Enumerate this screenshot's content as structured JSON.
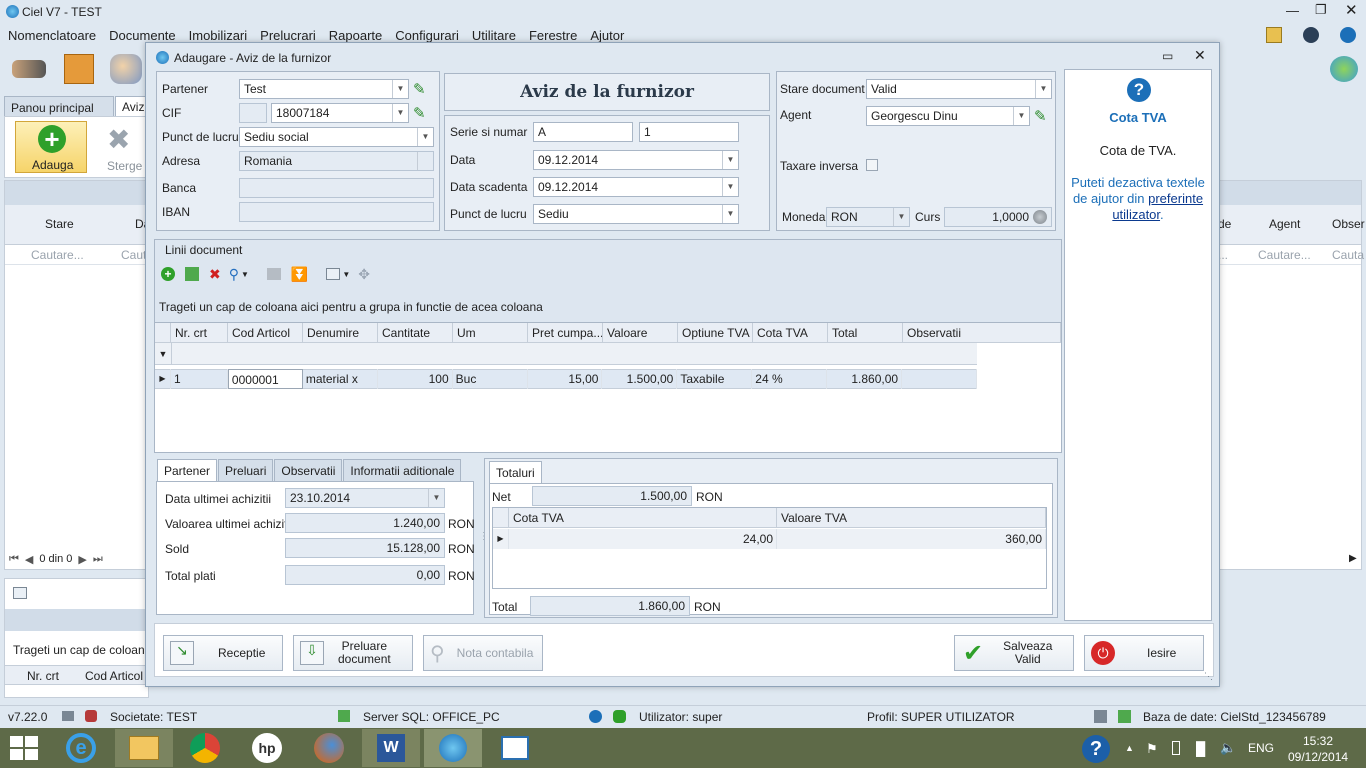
{
  "app": {
    "title": "Ciel V7 - TEST",
    "menu": [
      "Nomenclatoare",
      "Documente",
      "Imobilizari",
      "Prelucrari",
      "Rapoarte",
      "Configurari",
      "Utilitare",
      "Ferestre",
      "Ajutor"
    ]
  },
  "bg": {
    "tabs": [
      "Panou principal",
      "Aviz"
    ],
    "ribbon": {
      "add_label": "Adauga",
      "delete_label": "Sterge"
    },
    "grid_headers": [
      "Stare",
      "Da"
    ],
    "grid_headers_right": [
      "de",
      "Agent",
      "Obser"
    ],
    "search_left": [
      "Cautare...",
      "Caut"
    ],
    "search_right": [
      "...",
      "Cautare...",
      "Cauta"
    ],
    "pager": "0 din 0",
    "bottom_group_text": "Trageti un cap de coloana a",
    "bottom_headers": [
      "Nr. crt",
      "Cod Articol"
    ]
  },
  "dialog": {
    "title": "Adaugare - Aviz de la furnizor",
    "heading": "Aviz de la furnizor",
    "partner": {
      "label": "Partener",
      "value": "Test"
    },
    "cif": {
      "label": "CIF",
      "value": "18007184"
    },
    "work_point": {
      "label": "Punct de lucru",
      "value": "Sediu social"
    },
    "address": {
      "label": "Adresa",
      "value": "Romania"
    },
    "bank": {
      "label": "Banca",
      "value": ""
    },
    "iban": {
      "label": "IBAN",
      "value": ""
    },
    "serie": {
      "label": "Serie si numar",
      "series": "A",
      "number": "1"
    },
    "date": {
      "label": "Data",
      "value": "09.12.2014"
    },
    "due_date": {
      "label": "Data scadenta",
      "value": "09.12.2014"
    },
    "work_point2": {
      "label": "Punct de lucru",
      "value": "Sediu"
    },
    "doc_state": {
      "label": "Stare document",
      "value": "Valid"
    },
    "agent": {
      "label": "Agent",
      "value": "Georgescu Dinu"
    },
    "reverse_tax": {
      "label": "Taxare inversa"
    },
    "currency": {
      "label": "Moneda",
      "value": "RON",
      "rate_label": "Curs",
      "rate_value": "1,0000"
    },
    "lines": {
      "title": "Linii document",
      "group_hint": "Trageti un cap de coloana aici pentru a grupa in functie de acea coloana",
      "headers": [
        "Nr. crt",
        "Cod Articol",
        "Denumire",
        "Cantitate",
        "Um",
        "Pret cumpa...",
        "Valoare",
        "Optiune TVA",
        "Cota TVA",
        "Total",
        "Observatii"
      ],
      "rows": [
        [
          "1",
          "0000001",
          "material x",
          "100",
          "Buc",
          "15,00",
          "1.500,00",
          "Taxabile",
          "24 %",
          "1.860,00",
          ""
        ]
      ]
    },
    "bottom_tabs": [
      "Partener",
      "Preluari",
      "Observatii",
      "Informatii aditionale"
    ],
    "partner_info": {
      "last_purchase_date": {
        "label": "Data ultimei achizitii",
        "value": "23.10.2014"
      },
      "last_purchase_value": {
        "label": "Valoarea ultimei achizitii",
        "value": "1.240,00",
        "unit": "RON"
      },
      "balance": {
        "label": "Sold",
        "value": "15.128,00",
        "unit": "RON"
      },
      "total_payments": {
        "label": "Total plati",
        "value": "0,00",
        "unit": "RON"
      }
    },
    "totals": {
      "tab": "Totaluri",
      "net_label": "Net",
      "net_value": "1.500,00",
      "net_unit": "RON",
      "vat_headers": [
        "Cota TVA",
        "Valoare TVA"
      ],
      "vat_rows": [
        [
          "24,00",
          "360,00"
        ]
      ],
      "total_label": "Total",
      "total_value": "1.860,00",
      "total_unit": "RON"
    },
    "buttons": {
      "receptie": "Receptie",
      "preluare1": "Preluare",
      "preluare2": "document",
      "nota": "Nota contabila",
      "save1": "Salveaza",
      "save2": "Valid",
      "exit": "Iesire"
    },
    "help": {
      "title": "Cota TVA",
      "text": "Cota de TVA.",
      "text2": "Puteti dezactiva textele de ajutor din",
      "link": "preferinte utilizator",
      "dot": "."
    }
  },
  "status": {
    "version": "v7.22.0",
    "company": "Societate: TEST",
    "server": "Server SQL: OFFICE_PC",
    "user": "Utilizator: super",
    "profile": "Profil: SUPER UTILIZATOR",
    "db": "Baza de date: CielStd_123456789"
  },
  "taskbar": {
    "lang": "ENG",
    "time": "15:32",
    "date": "09/12/2014"
  },
  "colors": {
    "accent": "#1c6fb8",
    "help_title": "#1c6fb8",
    "grid_row": "#dfe8f3"
  }
}
